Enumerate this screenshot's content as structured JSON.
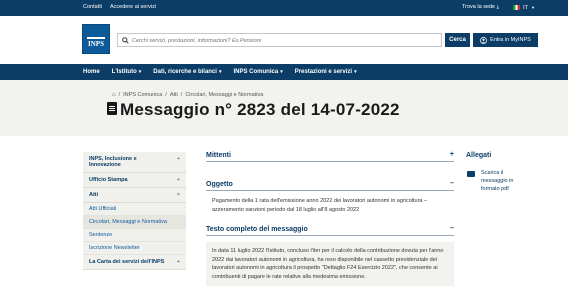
{
  "topbar": {
    "links": [
      "Contatti",
      "Accedere ai servizi"
    ],
    "trova_sede": "Trova la sede",
    "lang": "IT"
  },
  "header": {
    "logo_text": "INPS",
    "search_placeholder": "Cerchi servizi, prestazioni, informazioni? Es.Pensioni",
    "search_button": "Cerca",
    "login_button": "Entra in MyINPS"
  },
  "nav": {
    "items": [
      "Home",
      "L'Istituto",
      "Dati, ricerche e bilanci",
      "INPS Comunica",
      "Prestazioni e servizi"
    ]
  },
  "breadcrumb": [
    "INPS Comunica",
    "Atti",
    "Circolari, Messaggi e Normativa"
  ],
  "page_title": "Messaggio n° 2823 del 14-07-2022",
  "sidebar": {
    "items": [
      {
        "label": "INPS, Inclusione e Innovazione",
        "toggle": "+"
      },
      {
        "label": "Ufficio Stampa",
        "toggle": "+"
      },
      {
        "label": "Atti",
        "toggle": "×"
      }
    ],
    "subitems": [
      "Atti Ufficiali",
      "Circolari, Messaggi e Normativa",
      "Sentenze",
      "Iscrizione Newsletter"
    ],
    "last_item": {
      "label": "La Carta dei servizi dell'INPS",
      "toggle": "+"
    }
  },
  "sections": {
    "mittenti": {
      "title": "Mittenti",
      "toggle": "+"
    },
    "oggetto": {
      "title": "Oggetto",
      "toggle": "–",
      "text": "Pagamento della 1 rata dell'emissione anno 2022 dei lavoratori autonomi in agricoltura – azzeramento sanzioni periodo dal 18 luglio all'8 agosto 2022"
    },
    "testo": {
      "title": "Testo completo del messaggio",
      "toggle": "–",
      "text": "In data 11 luglio 2022 l'Istituto, concluso l'iter per il calcolo della contribuzione dovuta per l'anno 2022 dai lavoratori autonomi in agricoltura, ha reso disponibile nel cassetto previdenziale dei lavoratori autonomi in agricoltura il prospetto \"Dettaglio F24 Esercizio 2022\", che consente ai contribuenti di pagare le rate relative alla medesima emissione."
    }
  },
  "allegati": {
    "title": "Allegati",
    "items": [
      "Scarica il messaggio in formato pdf"
    ]
  }
}
